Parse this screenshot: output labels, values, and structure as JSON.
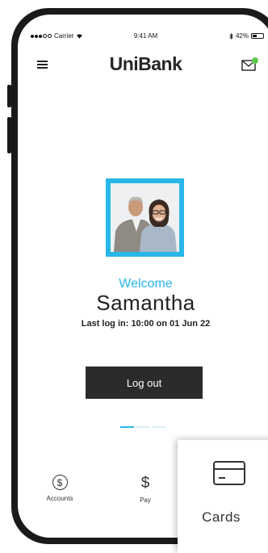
{
  "status_bar": {
    "carrier": "Carrier",
    "time": "9:41 AM",
    "battery": "42%",
    "battery_level": 0.42
  },
  "header": {
    "logo": "UniBank",
    "menu_icon": "hamburger-icon",
    "mail_icon": "mail-icon",
    "notification_color": "#5cc94a"
  },
  "profile": {
    "photo": "profile-photo",
    "welcome": "Welcome",
    "name": "Samantha",
    "last_login": "Last log in: 10:00 on 01 Jun 22"
  },
  "actions": {
    "logout_label": "Log out"
  },
  "pager": {
    "pages": 3,
    "active": 0
  },
  "tabs": [
    {
      "label": "Accounts",
      "icon": "dollar-circle-icon"
    },
    {
      "label": "Pay",
      "icon": "dollar-icon"
    },
    {
      "label": "Cards",
      "icon": "credit-card-icon"
    }
  ],
  "colors": {
    "accent": "#29b6e8",
    "button": "#2b2b2d",
    "text": "#222222"
  }
}
